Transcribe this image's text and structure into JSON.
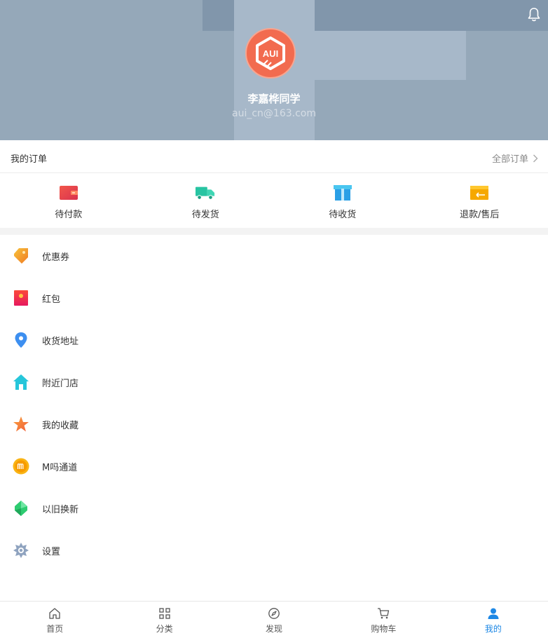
{
  "header": {
    "user_name": "李嘉桦同学",
    "user_email": "aui_cn@163.com",
    "avatar_text": "AUI",
    "icons": {
      "notification": "bell-icon"
    }
  },
  "orders": {
    "title": "我的订单",
    "all_label": "全部订单",
    "items": [
      {
        "label": "待付款",
        "icon": "wallet-icon",
        "color": "#e8463d"
      },
      {
        "label": "待发货",
        "icon": "truck-icon",
        "color": "#2fc6a3"
      },
      {
        "label": "待收货",
        "icon": "package-icon",
        "color": "#2ba6e8"
      },
      {
        "label": "退款/售后",
        "icon": "refund-icon",
        "color": "#f6a800"
      }
    ]
  },
  "menu": {
    "items": [
      {
        "label": "优惠券",
        "icon": "coupon-icon",
        "color": "#f39c2b"
      },
      {
        "label": "红包",
        "icon": "red-packet-icon",
        "color": "#f0224f"
      },
      {
        "label": "收货地址",
        "icon": "location-pin-icon",
        "color": "#3d8ff0"
      },
      {
        "label": "附近门店",
        "icon": "store-icon",
        "color": "#26c6da"
      },
      {
        "label": "我的收藏",
        "icon": "star-icon",
        "color": "#f57d3c"
      },
      {
        "label": "M吗通道",
        "icon": "m-coin-icon",
        "color": "#f6a600"
      },
      {
        "label": "以旧换新",
        "icon": "trade-in-icon",
        "color": "#2ecc71"
      },
      {
        "label": "设置",
        "icon": "gear-icon",
        "color": "#8fa3bf"
      }
    ]
  },
  "tabbar": {
    "active_color": "#1e88e5",
    "items": [
      {
        "label": "首页",
        "icon": "home-icon",
        "active": false
      },
      {
        "label": "分类",
        "icon": "grid-icon",
        "active": false
      },
      {
        "label": "发现",
        "icon": "compass-icon",
        "active": false
      },
      {
        "label": "购物车",
        "icon": "cart-icon",
        "active": false
      },
      {
        "label": "我的",
        "icon": "user-icon",
        "active": true
      }
    ]
  }
}
